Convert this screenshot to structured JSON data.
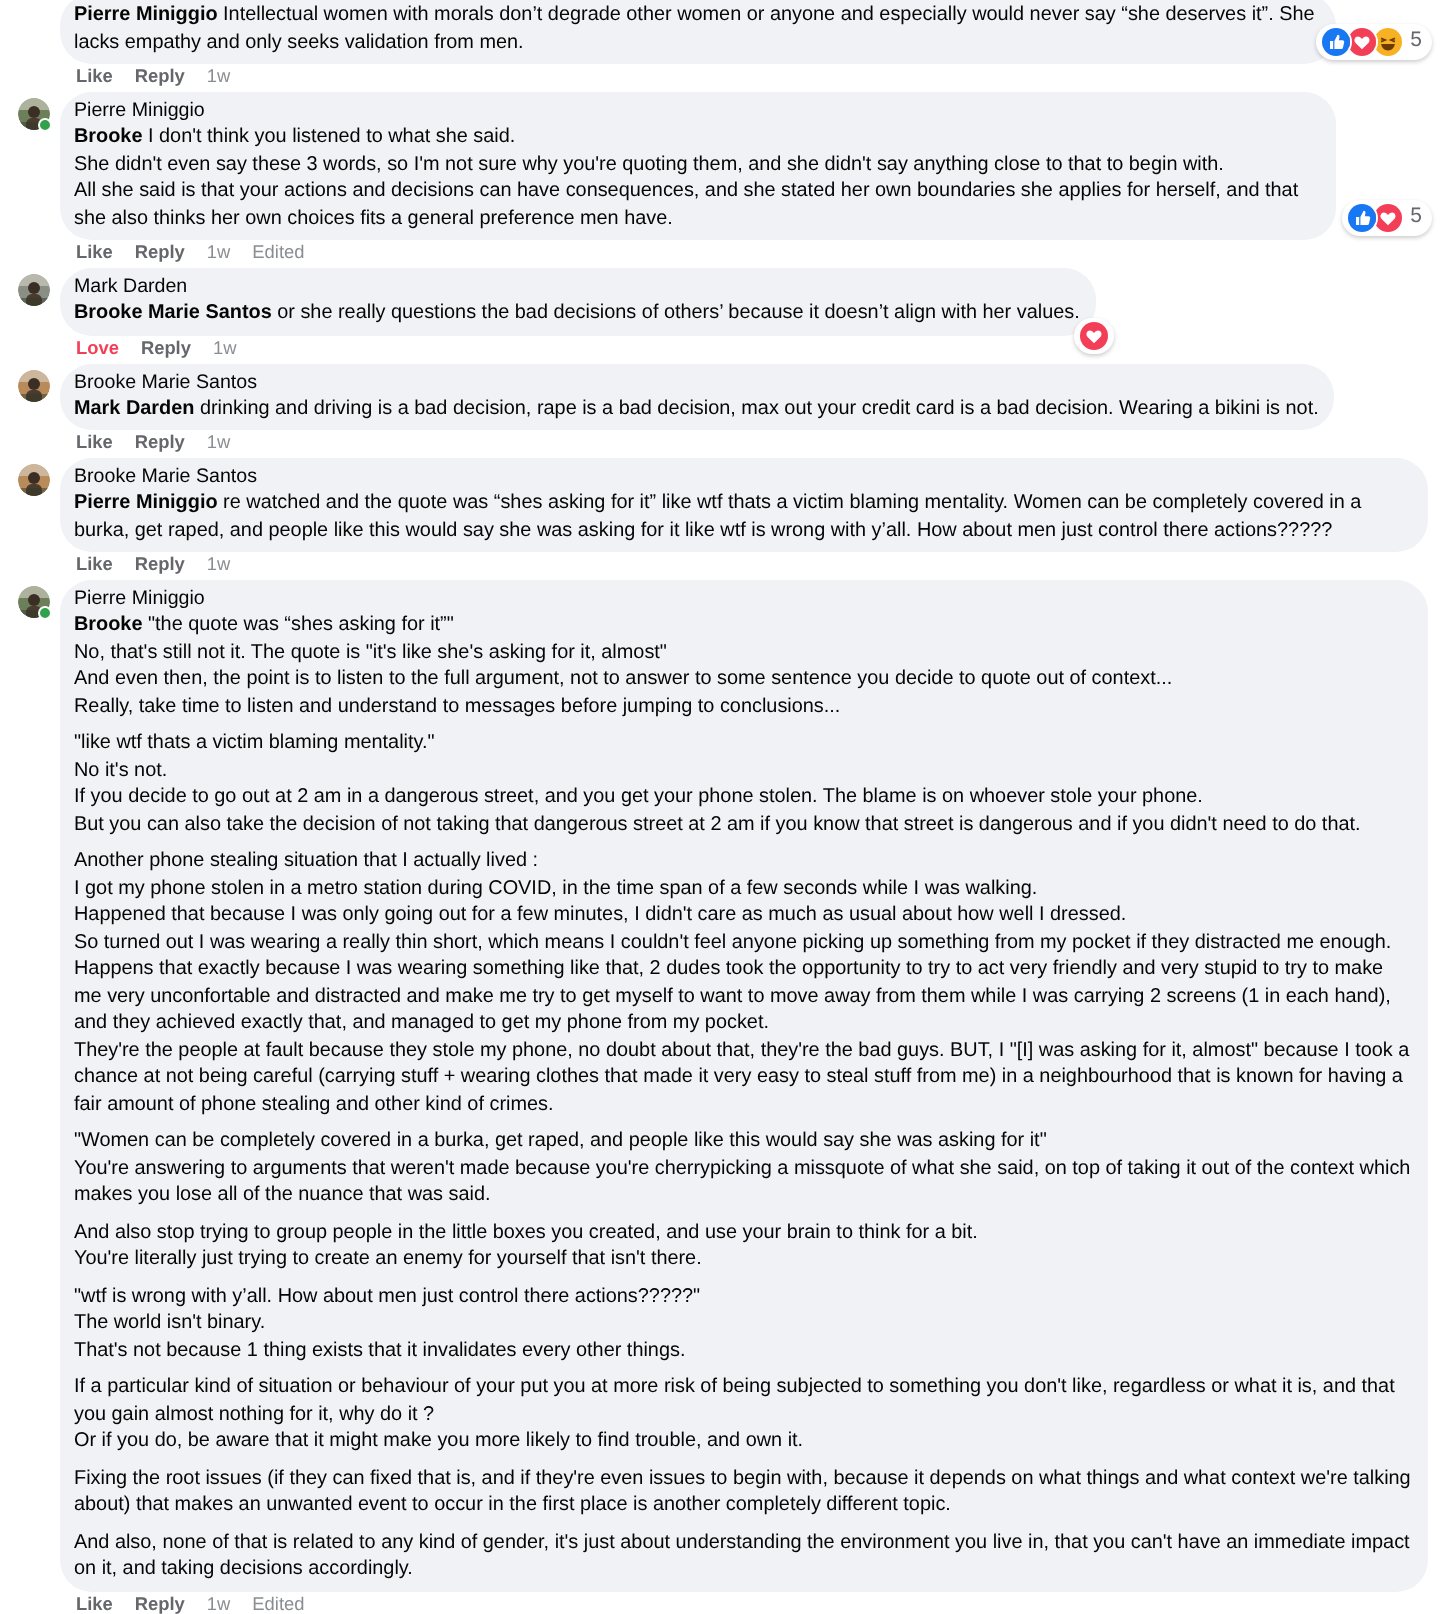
{
  "comments": [
    {
      "paragraphs": [
        "**Pierre Miniggio** Intellectual women with morals don’t degrade other women or anyone and especially would never say “she deserves it”. She lacks empathy and only seeks validation from men."
      ],
      "reactions": {
        "icons": [
          {
            "kind": "like"
          },
          {
            "kind": "love"
          },
          {
            "kind": "haha"
          }
        ],
        "count": "5"
      },
      "actions": [
        {
          "label": "Like",
          "kind": "like"
        },
        {
          "label": "Reply",
          "kind": "reply"
        },
        {
          "label": "1w",
          "kind": "time"
        }
      ]
    },
    {
      "author": "Pierre Miniggio",
      "avatar": {
        "color": "#6d7f5a",
        "online": true
      },
      "paragraphs": [
        "**Brooke** I don't think you listened to what she said.\nShe didn't even say these 3 words, so I'm not sure why you're quoting them, and she didn't say anything close to that to begin with.\nAll she said is that your actions and decisions can have consequences, and she stated her own boundaries she applies for herself, and that she also thinks her own choices fits a general preference men have."
      ],
      "reactions": {
        "icons": [
          {
            "kind": "like"
          },
          {
            "kind": "love"
          }
        ],
        "count": "5"
      },
      "actions": [
        {
          "label": "Like",
          "kind": "like"
        },
        {
          "label": "Reply",
          "kind": "reply"
        },
        {
          "label": "1w",
          "kind": "time"
        },
        {
          "label": "Edited",
          "kind": "time"
        }
      ]
    },
    {
      "author": "Mark Darden",
      "avatar": {
        "color": "#8a8f86"
      },
      "paragraphs": [
        "**Brooke Marie Santos** or she really questions the bad decisions of others’ because it doesn’t align with her values."
      ],
      "reactions": {
        "icons": [
          {
            "kind": "love"
          }
        ]
      },
      "actions": [
        {
          "label": "Love",
          "kind": "love"
        },
        {
          "label": "Reply",
          "kind": "reply"
        },
        {
          "label": "1w",
          "kind": "time"
        }
      ]
    },
    {
      "author": "Brooke Marie Santos",
      "avatar": {
        "color": "#b98a5a"
      },
      "paragraphs": [
        "**Mark Darden** drinking and driving is a bad decision, rape is a bad decision, max out your credit card is a bad decision. Wearing a bikini is not."
      ],
      "actions": [
        {
          "label": "Like",
          "kind": "like"
        },
        {
          "label": "Reply",
          "kind": "reply"
        },
        {
          "label": "1w",
          "kind": "time"
        }
      ]
    },
    {
      "author": "Brooke Marie Santos",
      "avatar": {
        "color": "#b98a5a"
      },
      "paragraphs": [
        "**Pierre Miniggio** re watched and the quote was “shes asking for it” like wtf thats a victim blaming mentality. Women can be completely covered in a burka, get raped, and people like this would say she was asking for it like wtf is wrong with y’all. How about men just control there actions?????"
      ],
      "actions": [
        {
          "label": "Like",
          "kind": "like"
        },
        {
          "label": "Reply",
          "kind": "reply"
        },
        {
          "label": "1w",
          "kind": "time"
        }
      ]
    },
    {
      "author": "Pierre Miniggio",
      "avatar": {
        "color": "#6d7f5a",
        "online": true
      },
      "paragraphs": [
        "**Brooke** \"the quote was “shes asking for it”\"\nNo, that's still not it. The quote is \"it's like she's asking for it, almost\"\nAnd even then, the point is to listen to the full argument, not to answer to some sentence you decide to quote out of context...\nReally, take time to listen and understand to messages before jumping to conclusions...",
        "\"like wtf thats a victim blaming mentality.\"\nNo it's not.\nIf you decide to go out at 2 am in a dangerous street, and you get your phone stolen. The blame is on whoever stole your phone.\nBut you can also take the decision of not taking that dangerous street at 2 am if you know that street is dangerous and if you didn't need to do that.",
        "Another phone stealing situation that I actually lived :\nI got my phone stolen in a metro station during COVID, in the time span of a few seconds while I was walking.\nHappened that because I was only going out for a few minutes, I didn't care as much as usual about how well I dressed.\nSo turned out I was wearing a really thin short, which means I couldn't feel anyone picking up something from my pocket if they distracted me enough.\nHappens that exactly because I was wearing something like that, 2 dudes took the opportunity to try to act very friendly and very stupid to try to make me very unconfortable and distracted and make me try to get myself to want to move away from them while I was carrying 2 screens (1 in each hand), and they achieved exactly that, and managed to get my phone from my pocket.\nThey're the people at fault because they stole my phone, no doubt about that, they're the bad guys. BUT, I \"[I] was asking for it, almost\" because I took a chance at not being careful (carrying stuff + wearing clothes that made it very easy to steal stuff from me) in a neighbourhood that is known for having a fair amount of phone stealing and other kind of crimes.",
        "\"Women can be completely covered in a burka, get raped, and people like this would say she was asking for it\"\nYou're answering to arguments that weren't made because you're cherrypicking a missquote of what she said, on top of taking it out of the context which makes you lose all of the nuance that was said.",
        "And also stop trying to group people in the little boxes you created, and use your brain to think for a bit.\nYou're literally just trying to create an enemy for yourself that isn't there.",
        "\"wtf is wrong with y’all. How about men just control there actions?????\"\nThe world isn't binary.\nThat's not because 1 thing exists that it invalidates every other things.",
        "If a particular kind of situation or behaviour of your put you at more risk of being subjected to something you don't like, regardless or what it is, and that you gain almost nothing for it, why do it ?\nOr if you do, be aware that it might make you more likely to find trouble, and own it.",
        "Fixing the root issues (if they can fixed that is, and if they're even issues to begin with, because it depends on what things and what context we're talking about) that makes an unwanted event to occur in the first place is another completely different topic.",
        "And also, none of that is related to any kind of gender, it's just about understanding the environment you live in, that you can't have an immediate impact on it, and taking decisions accordingly."
      ],
      "actions": [
        {
          "label": "Like",
          "kind": "like"
        },
        {
          "label": "Reply",
          "kind": "reply"
        },
        {
          "label": "1w",
          "kind": "time"
        },
        {
          "label": "Edited",
          "kind": "time"
        }
      ]
    }
  ]
}
